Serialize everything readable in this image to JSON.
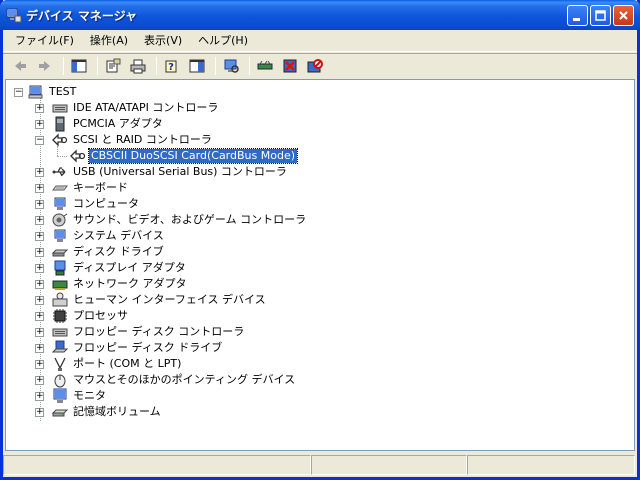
{
  "window": {
    "title": "デバイス マネージャ"
  },
  "menu": [
    {
      "label": "ファイル(F)"
    },
    {
      "label": "操作(A)"
    },
    {
      "label": "表示(V)"
    },
    {
      "label": "ヘルプ(H)"
    }
  ],
  "toolbar": {
    "buttons": [
      "back-icon",
      "forward-icon",
      "console-tree-icon",
      "properties-icon",
      "print-icon",
      "help-icon",
      "show-hide-icon",
      "scan-hardware-icon",
      "update-driver-icon",
      "uninstall-icon",
      "disable-icon"
    ]
  },
  "tree": {
    "root": "TEST",
    "items": [
      {
        "label": "IDE ATA/ATAPI コントローラ",
        "icon": "ide-controller-icon",
        "expanded": false
      },
      {
        "label": "PCMCIA アダプタ",
        "icon": "pcmcia-icon",
        "expanded": false
      },
      {
        "label": "SCSI と RAID コントローラ",
        "icon": "scsi-icon",
        "expanded": true,
        "children": [
          {
            "label": "CBSCII DuoSCSI Card(CardBus Mode)",
            "icon": "scsi-icon",
            "selected": true
          }
        ]
      },
      {
        "label": "USB (Universal Serial Bus) コントローラ",
        "icon": "usb-icon",
        "expanded": false
      },
      {
        "label": "キーボード",
        "icon": "keyboard-icon",
        "expanded": false
      },
      {
        "label": "コンピュータ",
        "icon": "computer-icon",
        "expanded": false
      },
      {
        "label": "サウンド、ビデオ、およびゲーム コントローラ",
        "icon": "sound-icon",
        "expanded": false
      },
      {
        "label": "システム デバイス",
        "icon": "system-device-icon",
        "expanded": false
      },
      {
        "label": "ディスク ドライブ",
        "icon": "disk-drive-icon",
        "expanded": false
      },
      {
        "label": "ディスプレイ アダプタ",
        "icon": "display-adapter-icon",
        "expanded": false
      },
      {
        "label": "ネットワーク アダプタ",
        "icon": "network-adapter-icon",
        "expanded": false
      },
      {
        "label": "ヒューマン インターフェイス デバイス",
        "icon": "hid-icon",
        "expanded": false
      },
      {
        "label": "プロセッサ",
        "icon": "processor-icon",
        "expanded": false
      },
      {
        "label": "フロッピー ディスク コントローラ",
        "icon": "floppy-controller-icon",
        "expanded": false
      },
      {
        "label": "フロッピー ディスク ドライブ",
        "icon": "floppy-drive-icon",
        "expanded": false
      },
      {
        "label": "ポート (COM と LPT)",
        "icon": "port-icon",
        "expanded": false
      },
      {
        "label": "マウスとそのほかのポインティング デバイス",
        "icon": "mouse-icon",
        "expanded": false
      },
      {
        "label": "モニタ",
        "icon": "monitor-icon",
        "expanded": false
      },
      {
        "label": "記憶域ボリューム",
        "icon": "storage-volume-icon",
        "expanded": false
      }
    ]
  },
  "colors": {
    "title_blue": "#0A4ED2",
    "selection": "#316AC5",
    "chrome": "#ECE9D8"
  }
}
